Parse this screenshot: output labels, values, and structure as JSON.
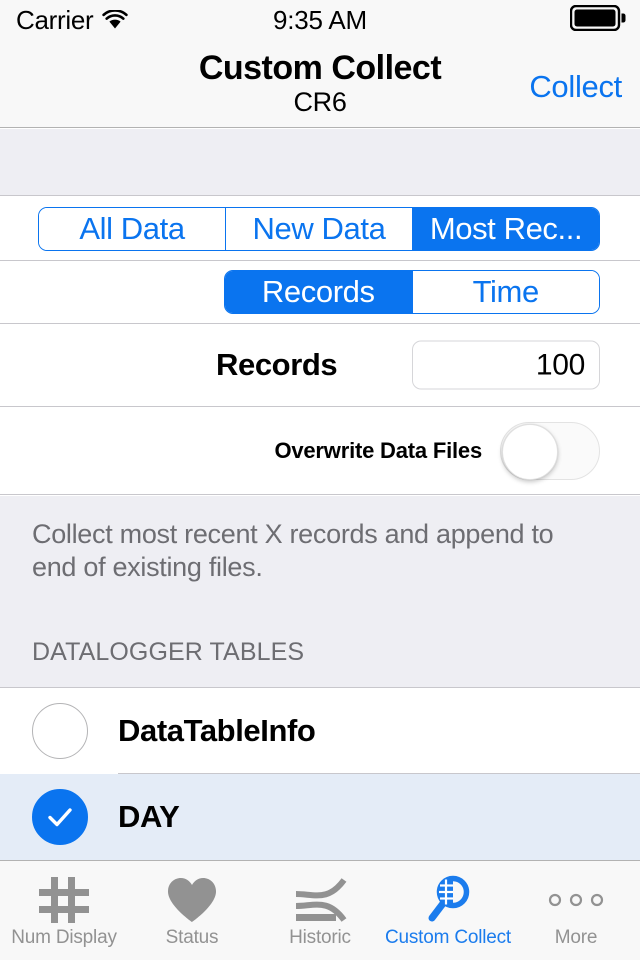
{
  "colors": {
    "accent_blue": "#0a74ef",
    "tab_active_blue": "#1b7ced",
    "inactive_gray": "#929292",
    "group_bg": "#eeeef3",
    "selected_row": "#e4ecf7",
    "separator": "#c8c7cc",
    "footer_text": "#6d6d72"
  },
  "status_bar": {
    "carrier": "Carrier",
    "wifi_icon": "wifi-icon",
    "time": "9:35 AM",
    "battery_icon": "battery-full-icon"
  },
  "nav_bar": {
    "title": "Custom Collect",
    "subtitle": "CR6",
    "right_button": "Collect"
  },
  "settings": {
    "mode_segment": {
      "options": [
        "All Data",
        "New Data",
        "Most Rec..."
      ],
      "selected_index": 2
    },
    "unit_segment": {
      "options": [
        "Records",
        "Time"
      ],
      "selected_index": 0
    },
    "records_row": {
      "label": "Records",
      "value": "100",
      "placeholder": "Records"
    },
    "overwrite_row": {
      "label": "Overwrite Data Files",
      "toggle_state": "off"
    }
  },
  "description": {
    "text": "Collect most recent X records and append to end of existing files.",
    "section_header": "DATALOGGER TABLES"
  },
  "table_list": {
    "rows": [
      {
        "label": "DataTableInfo",
        "selected": false
      },
      {
        "label": "DAY",
        "selected": true
      }
    ]
  },
  "tab_bar": {
    "items": [
      {
        "label": "Num Display",
        "icon": "hash-grid-icon",
        "active": false
      },
      {
        "label": "Status",
        "icon": "heart-icon",
        "active": false
      },
      {
        "label": "Historic",
        "icon": "crossing-lines-chart-icon",
        "active": false
      },
      {
        "label": "Custom Collect",
        "icon": "magnifier-grid-icon",
        "active": true
      },
      {
        "label": "More",
        "icon": "three-dots-icon",
        "active": false
      }
    ]
  }
}
